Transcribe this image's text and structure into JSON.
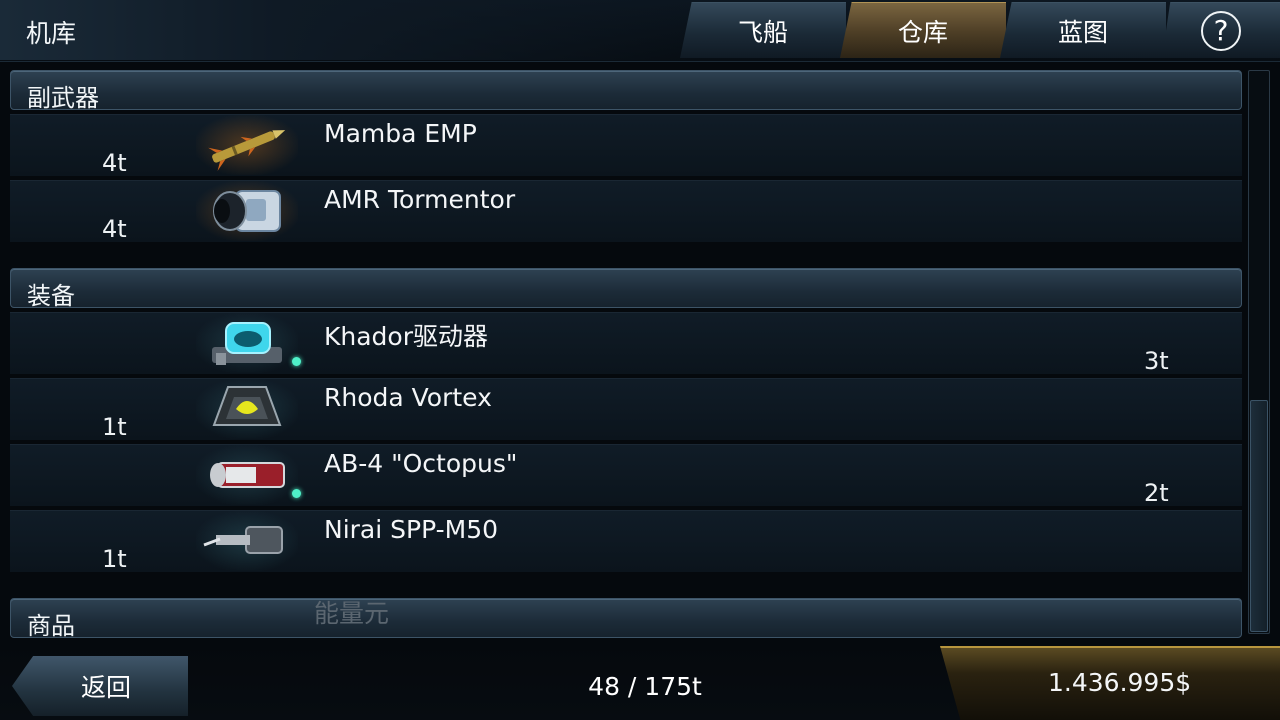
{
  "header": {
    "title": "机库",
    "tabs": [
      {
        "label": "飞船",
        "active": false
      },
      {
        "label": "仓库",
        "active": true
      },
      {
        "label": "蓝图",
        "active": false
      }
    ],
    "help_label": "?"
  },
  "sections": {
    "secondary_weapons": "副武器",
    "equipment": "装备",
    "goods": "商品"
  },
  "items": {
    "mamba": {
      "name": "Mamba EMP",
      "weight": "4t",
      "icon": "missile-icon"
    },
    "amr": {
      "name": "AMR Tormentor",
      "weight": "4t",
      "icon": "torpedo-icon"
    },
    "khador": {
      "name": "Khador驱动器",
      "weight": "3t",
      "icon": "drive-icon",
      "equipped": true
    },
    "rhoda": {
      "name": "Rhoda Vortex",
      "weight": "1t",
      "icon": "vortex-icon"
    },
    "octopus": {
      "name": "AB-4 \"Octopus\"",
      "weight": "2t",
      "icon": "octopus-icon",
      "equipped": true
    },
    "nirai": {
      "name": "Nirai SPP-M50",
      "weight": "1t",
      "icon": "gun-icon"
    },
    "energy_cell": {
      "name": "能量元"
    }
  },
  "footer": {
    "back_label": "返回",
    "cargo": "48 / 175t",
    "credits": "1.436.995$"
  },
  "colors": {
    "accent_gold": "#b8963e",
    "panel_blue": "#2e4252",
    "equipped_indicator": "#4ff0c8"
  }
}
